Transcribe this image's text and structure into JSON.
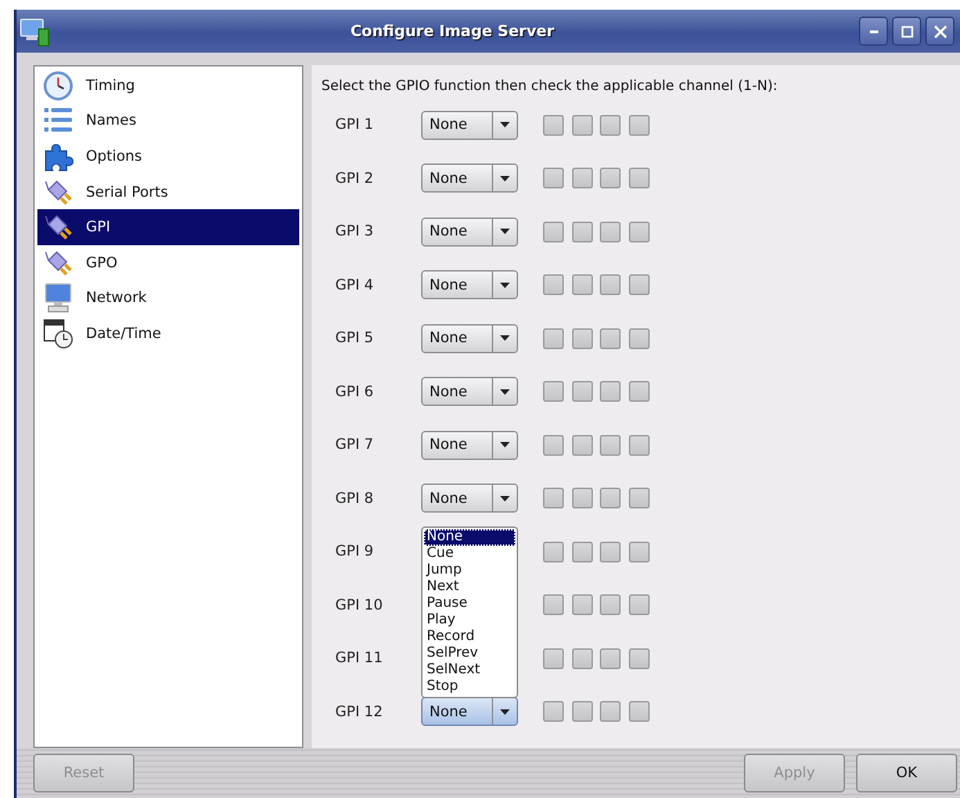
{
  "window": {
    "title": "Configure Image Server"
  },
  "sidebar": {
    "items": [
      {
        "label": "Timing",
        "kind": "clock",
        "selected": false
      },
      {
        "label": "Names",
        "kind": "list",
        "selected": false
      },
      {
        "label": "Options",
        "kind": "puzzle",
        "selected": false
      },
      {
        "label": "Serial Ports",
        "kind": "plug",
        "selected": false
      },
      {
        "label": "GPI",
        "kind": "plug",
        "selected": true
      },
      {
        "label": "GPO",
        "kind": "plug",
        "selected": false
      },
      {
        "label": "Network",
        "kind": "monitor",
        "selected": false
      },
      {
        "label": "Date/Time",
        "kind": "calendar",
        "selected": false
      }
    ]
  },
  "instructions": "Select the GPIO function then check the applicable channel (1-N):",
  "gpi_rows": [
    {
      "label": "GPI 1",
      "function": "None",
      "open": false,
      "channels": [
        {
          "checked": false
        },
        {
          "checked": false
        },
        {
          "checked": false
        },
        {
          "checked": false
        }
      ]
    },
    {
      "label": "GPI 2",
      "function": "None",
      "open": false,
      "channels": [
        {
          "checked": false
        },
        {
          "checked": false
        },
        {
          "checked": false
        },
        {
          "checked": false
        }
      ]
    },
    {
      "label": "GPI 3",
      "function": "None",
      "open": false,
      "channels": [
        {
          "checked": false
        },
        {
          "checked": false
        },
        {
          "checked": false
        },
        {
          "checked": false
        }
      ]
    },
    {
      "label": "GPI 4",
      "function": "None",
      "open": false,
      "channels": [
        {
          "checked": false
        },
        {
          "checked": false
        },
        {
          "checked": false
        },
        {
          "checked": false
        }
      ]
    },
    {
      "label": "GPI 5",
      "function": "None",
      "open": false,
      "channels": [
        {
          "checked": false
        },
        {
          "checked": false
        },
        {
          "checked": false
        },
        {
          "checked": false
        }
      ]
    },
    {
      "label": "GPI 6",
      "function": "None",
      "open": false,
      "channels": [
        {
          "checked": false
        },
        {
          "checked": false
        },
        {
          "checked": false
        },
        {
          "checked": false
        }
      ]
    },
    {
      "label": "GPI 7",
      "function": "None",
      "open": false,
      "channels": [
        {
          "checked": false
        },
        {
          "checked": false
        },
        {
          "checked": false
        },
        {
          "checked": false
        }
      ]
    },
    {
      "label": "GPI 8",
      "function": "None",
      "open": false,
      "channels": [
        {
          "checked": false
        },
        {
          "checked": false
        },
        {
          "checked": false
        },
        {
          "checked": false
        }
      ]
    },
    {
      "label": "GPI 9",
      "open": false,
      "channels": [
        {
          "checked": false
        },
        {
          "checked": false
        },
        {
          "checked": false
        },
        {
          "checked": false
        }
      ]
    },
    {
      "label": "GPI 10",
      "open": false,
      "channels": [
        {
          "checked": false
        },
        {
          "checked": false
        },
        {
          "checked": false
        },
        {
          "checked": false
        }
      ]
    },
    {
      "label": "GPI 11",
      "open": false,
      "channels": [
        {
          "checked": false
        },
        {
          "checked": false
        },
        {
          "checked": false
        },
        {
          "checked": false
        }
      ]
    },
    {
      "label": "GPI 12",
      "function": "None",
      "open": true,
      "options": [
        {
          "label": "None",
          "selected": true
        },
        {
          "label": "Cue",
          "selected": false
        },
        {
          "label": "Jump",
          "selected": false
        },
        {
          "label": "Next",
          "selected": false
        },
        {
          "label": "Pause",
          "selected": false
        },
        {
          "label": "Play",
          "selected": false
        },
        {
          "label": "Record",
          "selected": false
        },
        {
          "label": "SelPrev",
          "selected": false
        },
        {
          "label": "SelNext",
          "selected": false
        },
        {
          "label": "Stop",
          "selected": false
        }
      ],
      "channels": [
        {
          "checked": false
        },
        {
          "checked": false
        },
        {
          "checked": false
        },
        {
          "checked": false
        }
      ]
    }
  ],
  "buttons": [
    {
      "label": "Reset",
      "disabled": true
    },
    {
      "label": "Apply",
      "disabled": true
    },
    {
      "label": "OK",
      "disabled": false
    }
  ]
}
